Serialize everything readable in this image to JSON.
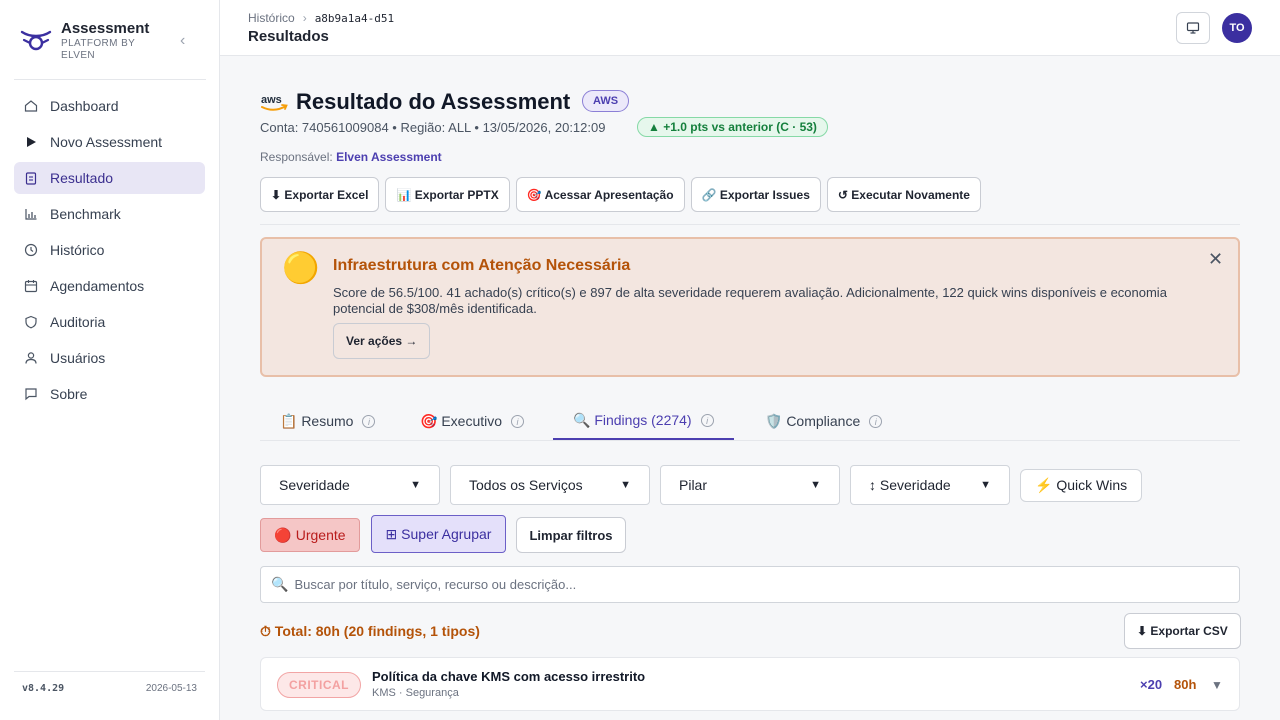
{
  "brand": {
    "title": "Assessment",
    "subtitle": "PLATFORM BY ELVEN",
    "collapse_glyph": "‹"
  },
  "sidebar": {
    "items": [
      {
        "label": "Dashboard",
        "icon": "home-icon",
        "active": false
      },
      {
        "label": "Novo Assessment",
        "icon": "play-icon",
        "active": false
      },
      {
        "label": "Resultado",
        "icon": "clipboard-icon",
        "active": true
      },
      {
        "label": "Benchmark",
        "icon": "bar-chart-icon",
        "active": false
      },
      {
        "label": "Histórico",
        "icon": "clock-icon",
        "active": false
      },
      {
        "label": "Agendamentos",
        "icon": "calendar-icon",
        "active": false
      },
      {
        "label": "Auditoria",
        "icon": "shield-icon",
        "active": false
      },
      {
        "label": "Usuários",
        "icon": "user-icon",
        "active": false
      },
      {
        "label": "Sobre",
        "icon": "message-square-icon",
        "active": false
      }
    ],
    "version": "v8.4.29",
    "date": "2026-05-13"
  },
  "header": {
    "breadcrumb_parent": "Histórico",
    "breadcrumb_sep": "›",
    "breadcrumb_id": "a8b9a1a4-d51",
    "title": "Resultados",
    "avatar_initials": "TO"
  },
  "result": {
    "title": "Resultado do Assessment",
    "provider_badge": "AWS",
    "meta": "Conta: 740561009084 • Região: ALL • 13/05/2026, 20:12:09",
    "delta": "▲ +1.0 pts vs anterior (C · 53)",
    "responsible_label": "Responsável:",
    "responsible_name": "Elven Assessment"
  },
  "actions": {
    "export_excel": "⬇ Exportar Excel",
    "export_pptx": "📊 Exportar PPTX",
    "presentation": "🎯 Acessar Apresentação",
    "export_issues": "🔗 Exportar Issues",
    "run_again": "↺ Executar Novamente"
  },
  "alert": {
    "emoji": "🟡",
    "title": "Infraestrutura com Atenção Necessária",
    "text": "Score de 56.5/100. 41 achado(s) crítico(s) e 897 de alta severidade requerem avaliação. Adicionalmente, 122 quick wins disponíveis e economia potencial de $308/mês identificada.",
    "button": "Ver ações →",
    "close": "✕"
  },
  "tabs": [
    {
      "label": "📋 Resumo",
      "active": false
    },
    {
      "label": "🎯 Executivo",
      "active": false
    },
    {
      "label": "🔍 Findings (2274)",
      "active": true
    },
    {
      "label": "🛡️ Compliance",
      "active": false
    }
  ],
  "filters": {
    "severity": "Severidade",
    "services": "Todos os Serviços",
    "pillar": "Pilar",
    "sort": "↕ Severidade",
    "quick_wins": "⚡ Quick Wins",
    "urgent": "🔴 Urgente",
    "super_group": "⊞ Super Agrupar",
    "clear": "Limpar filtros",
    "search_placeholder": "Buscar por título, serviço, recurso ou descrição..."
  },
  "summary": {
    "total": "⏱ Total: 80h (20 findings, 1 tipos)",
    "export_csv": "⬇ Exportar CSV"
  },
  "findings": [
    {
      "severity": "CRITICAL",
      "title": "Política da chave KMS com acesso irrestrito",
      "subtitle": "KMS · Segurança",
      "count": "×20",
      "hours": "80h",
      "toggle": "▼"
    }
  ],
  "colors": {
    "accent": "#4c3fb0",
    "warning": "#b45309",
    "success": "#15803d",
    "critical": "#b91c1c"
  }
}
